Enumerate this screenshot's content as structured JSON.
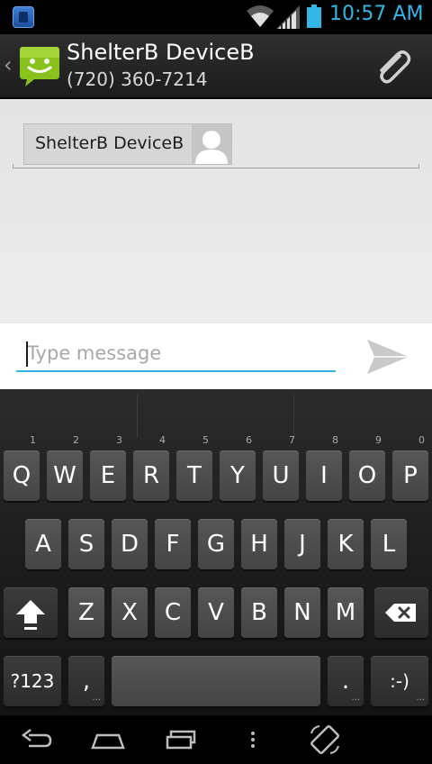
{
  "status_bar": {
    "time": "10:57 AM",
    "notification_icon": "app-notification-icon",
    "wifi_icon": "wifi-icon",
    "signal_icon": "cell-signal-icon",
    "battery_icon": "battery-icon",
    "accent_color": "#33b5e5"
  },
  "action_bar": {
    "back_icon": "chevron-left-icon",
    "avatar_icon": "android-messaging-icon",
    "contact_name": "ShelterB DeviceB",
    "contact_number": "(720) 360-7214",
    "attach_icon": "paperclip-icon"
  },
  "recipients": {
    "chip_label": "ShelterB DeviceB",
    "chip_photo_icon": "contact-placeholder-icon"
  },
  "compose": {
    "input_value": "",
    "input_placeholder": "Type message",
    "send_icon": "send-icon"
  },
  "keyboard": {
    "row1": [
      {
        "label": "Q",
        "hint": "1"
      },
      {
        "label": "W",
        "hint": "2"
      },
      {
        "label": "E",
        "hint": "3"
      },
      {
        "label": "R",
        "hint": "4"
      },
      {
        "label": "T",
        "hint": "5"
      },
      {
        "label": "Y",
        "hint": "6"
      },
      {
        "label": "U",
        "hint": "7"
      },
      {
        "label": "I",
        "hint": "8"
      },
      {
        "label": "O",
        "hint": "9"
      },
      {
        "label": "P",
        "hint": "0"
      }
    ],
    "row2": [
      "A",
      "S",
      "D",
      "F",
      "G",
      "H",
      "J",
      "K",
      "L"
    ],
    "row3": [
      "Z",
      "X",
      "C",
      "V",
      "B",
      "N",
      "M"
    ],
    "shift_icon": "shift-arrow-icon",
    "delete_icon": "backspace-icon",
    "symbols_label": "?123",
    "comma_label": ",",
    "space_label": "",
    "period_label": ".",
    "smiley_label": ":-)",
    "more_dots": "..."
  },
  "nav_bar": {
    "back_icon": "nav-back-icon",
    "home_icon": "nav-home-icon",
    "recents_icon": "nav-recents-icon",
    "menu_icon": "nav-menu-icon",
    "rotate_icon": "screen-rotate-icon"
  }
}
